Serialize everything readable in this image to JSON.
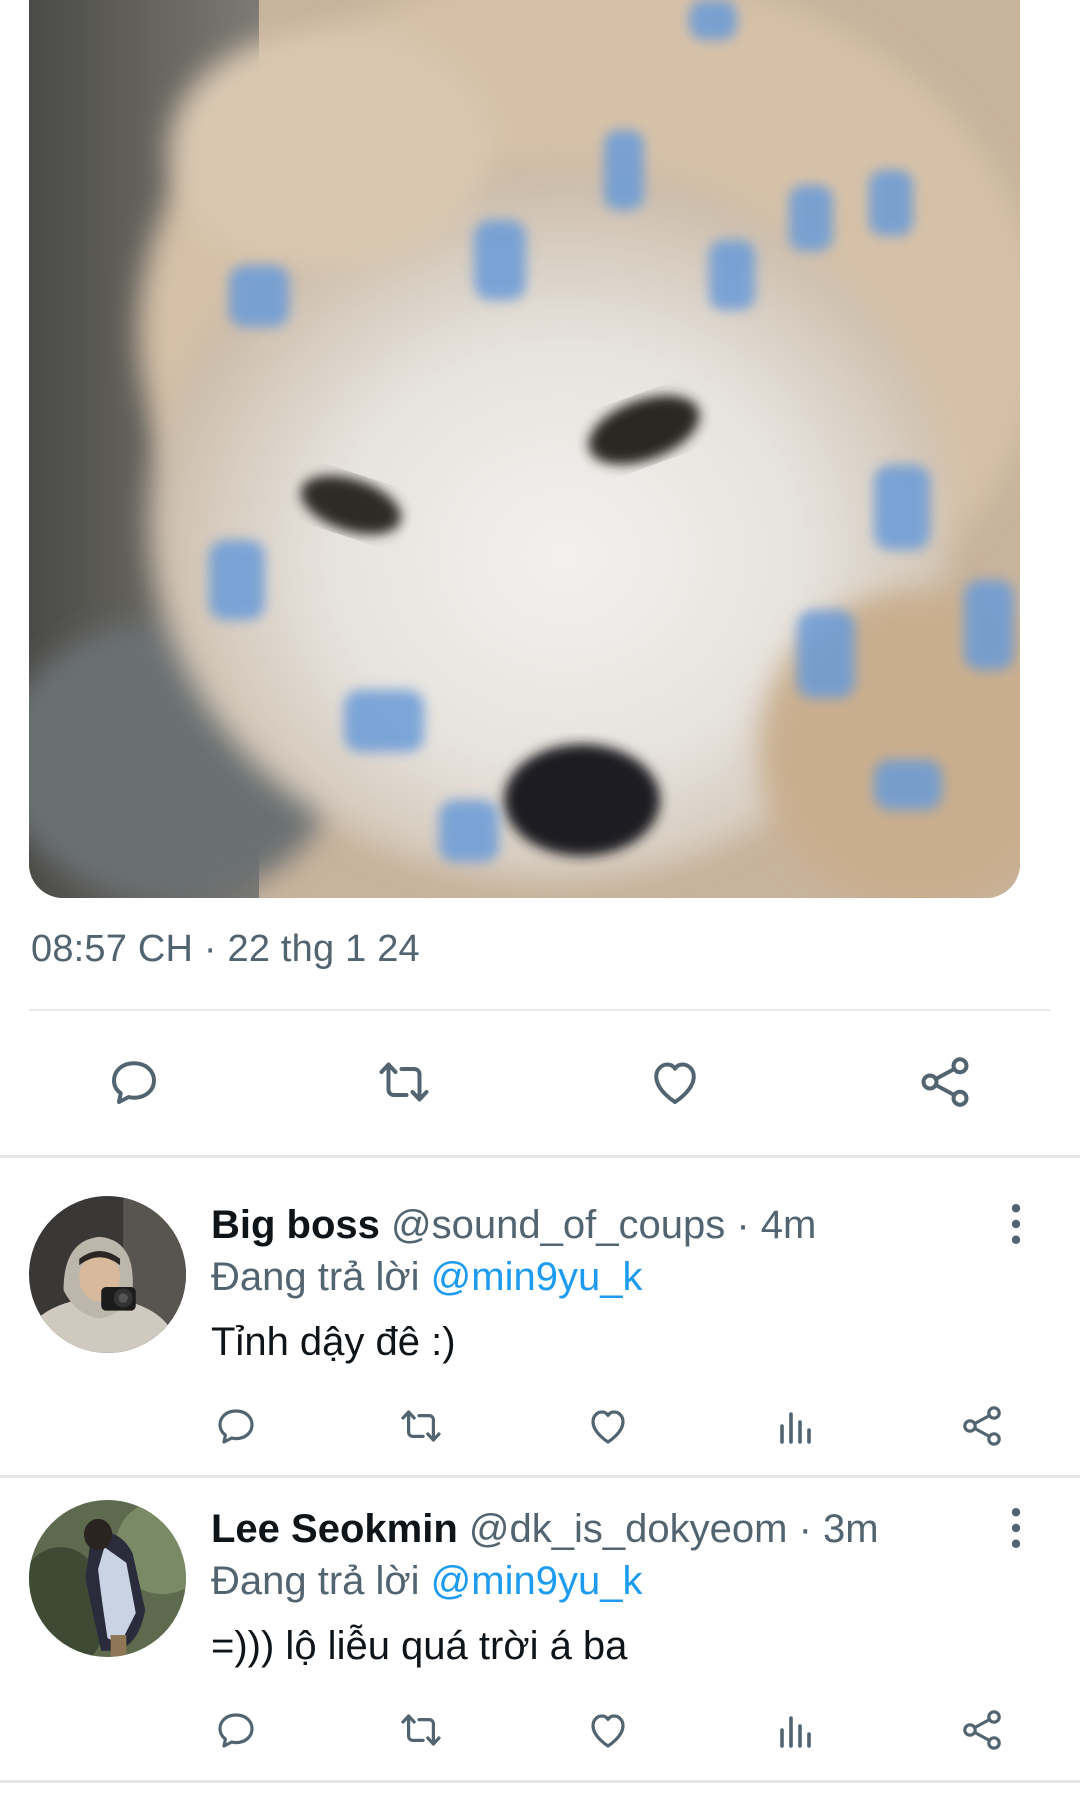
{
  "colors": {
    "icon_gray": "#536471",
    "text_primary": "#0f1419",
    "text_secondary": "#536471",
    "link_blue": "#1d9bf0",
    "divider": "#e7e9eb"
  },
  "main_tweet": {
    "timestamp": "08:57 CH · 22 thg 1 24",
    "actions": [
      "reply-icon",
      "retweet-icon",
      "like-icon",
      "share-icon"
    ]
  },
  "replies": [
    {
      "display_name": "Big boss",
      "handle": "@sound_of_coups",
      "separator": "·",
      "age": "4m",
      "reply_prefix": "Đang trả lời",
      "reply_mention": "@min9yu_k",
      "text": "Tỉnh dậy đê :)",
      "actions": [
        "reply-icon",
        "retweet-icon",
        "like-icon",
        "views-icon",
        "share-icon"
      ]
    },
    {
      "display_name": "Lee Seokmin",
      "handle": "@dk_is_dokyeom",
      "separator": "·",
      "age": "3m",
      "reply_prefix": "Đang trả lời",
      "reply_mention": "@min9yu_k",
      "text": "=))) lộ liễu quá trời á ba",
      "actions": [
        "reply-icon",
        "retweet-icon",
        "like-icon",
        "views-icon",
        "share-icon"
      ]
    }
  ]
}
